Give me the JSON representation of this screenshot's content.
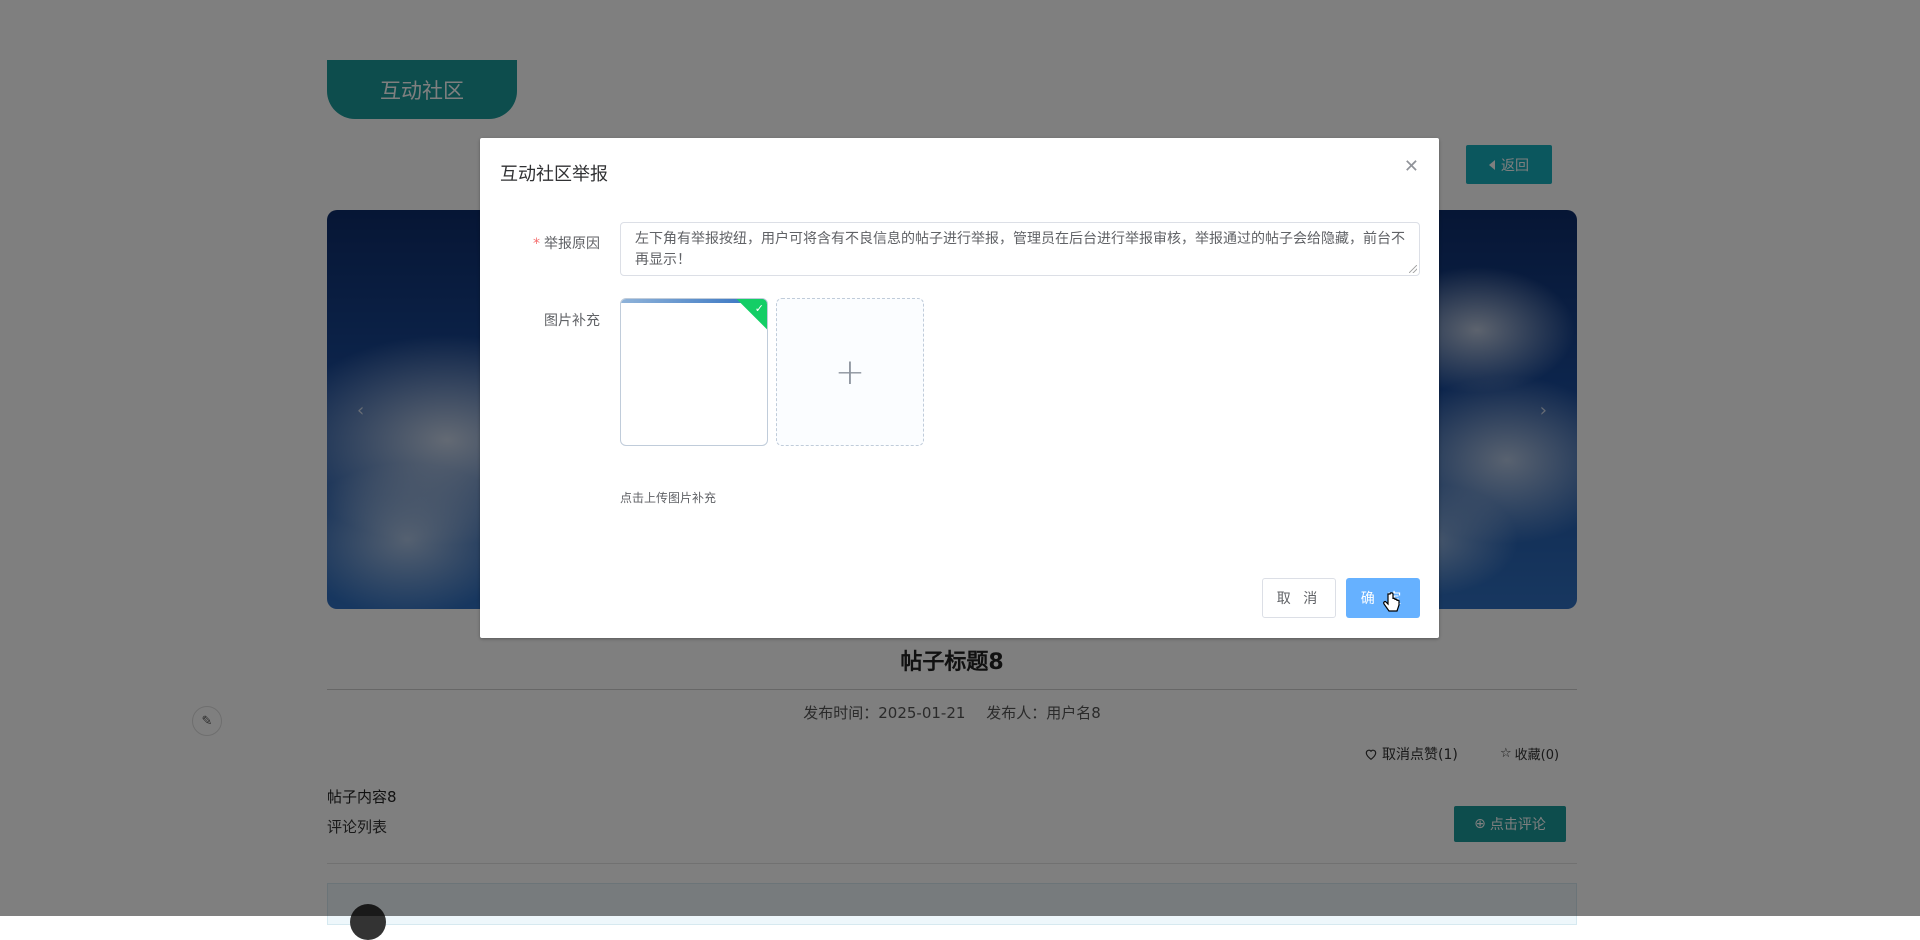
{
  "header": {
    "section_title": "互动社区",
    "back_label": "返回"
  },
  "post": {
    "title": "帖子标题8",
    "publish_time_label": "发布时间：2025-01-21",
    "publisher_label": "发布人：用户名8",
    "like_label": "取消点赞(1)",
    "favorite_label": "收藏(0)",
    "content": "帖子内容8",
    "comment_list_label": "评论列表",
    "comment_button_label": "点击评论"
  },
  "dialog": {
    "title": "互动社区举报",
    "reason_label": "举报原因",
    "reason_value": "左下角有举报按纽，用户可将含有不良信息的帖子进行举报，管理员在后台进行举报审核，举报通过的帖子会给隐藏，前台不再显示！",
    "image_label": "图片补充",
    "upload_tip": "点击上传图片补充",
    "cancel_label": "取 消",
    "confirm_label": "确 定"
  },
  "icons": {
    "close": "close-icon",
    "plus": "plus-icon",
    "check": "check-icon",
    "heart": "heart-icon",
    "star": "star-icon",
    "comment": "plus-circle-icon",
    "edit": "edit-icon"
  },
  "colors": {
    "accent": "#1a9a9a",
    "back_button": "#17aebc",
    "confirm": "#66b1ff",
    "success": "#13ce66",
    "required": "#f56c6c"
  }
}
